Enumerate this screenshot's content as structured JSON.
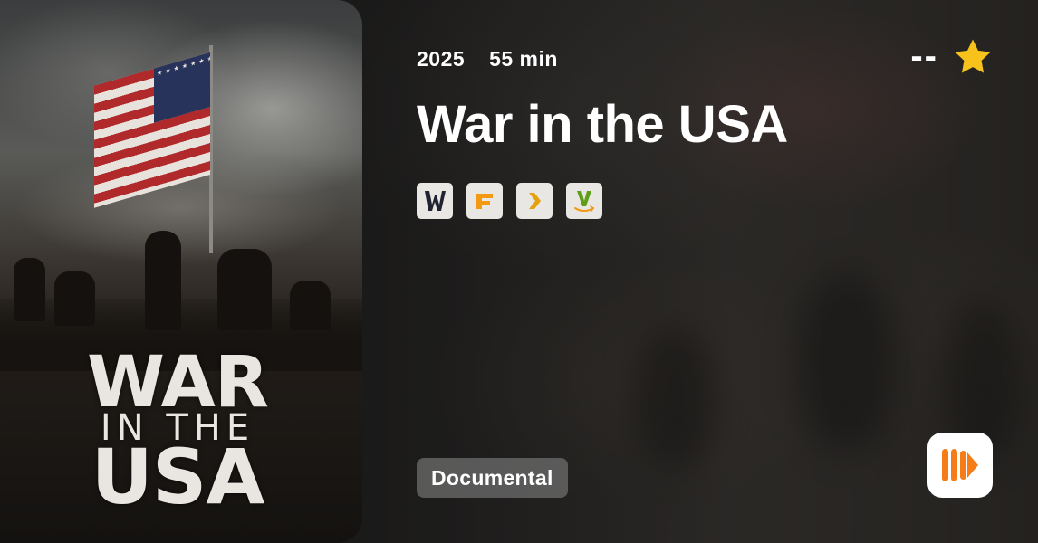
{
  "movie": {
    "year": "2025",
    "duration": "55 min",
    "title": "War in the USA",
    "rating": "--",
    "genre": "Documental"
  },
  "poster": {
    "title_line1": "WAR",
    "title_line2": "IN THE",
    "title_line3": "USA"
  },
  "providers": [
    {
      "icon": "w-provider-icon",
      "glyph": "W",
      "color": "#1f2230"
    },
    {
      "icon": "f-provider-icon",
      "glyph": "F",
      "color": "#f39a12"
    },
    {
      "icon": "plex-provider-icon",
      "glyph": "❯",
      "color": "#e5a00d"
    },
    {
      "icon": "amazon-video-provider-icon",
      "glyph": "V",
      "color": "#5f9e17"
    }
  ],
  "colors": {
    "star": "#f7c21b",
    "app_icon": "#f57c16"
  }
}
